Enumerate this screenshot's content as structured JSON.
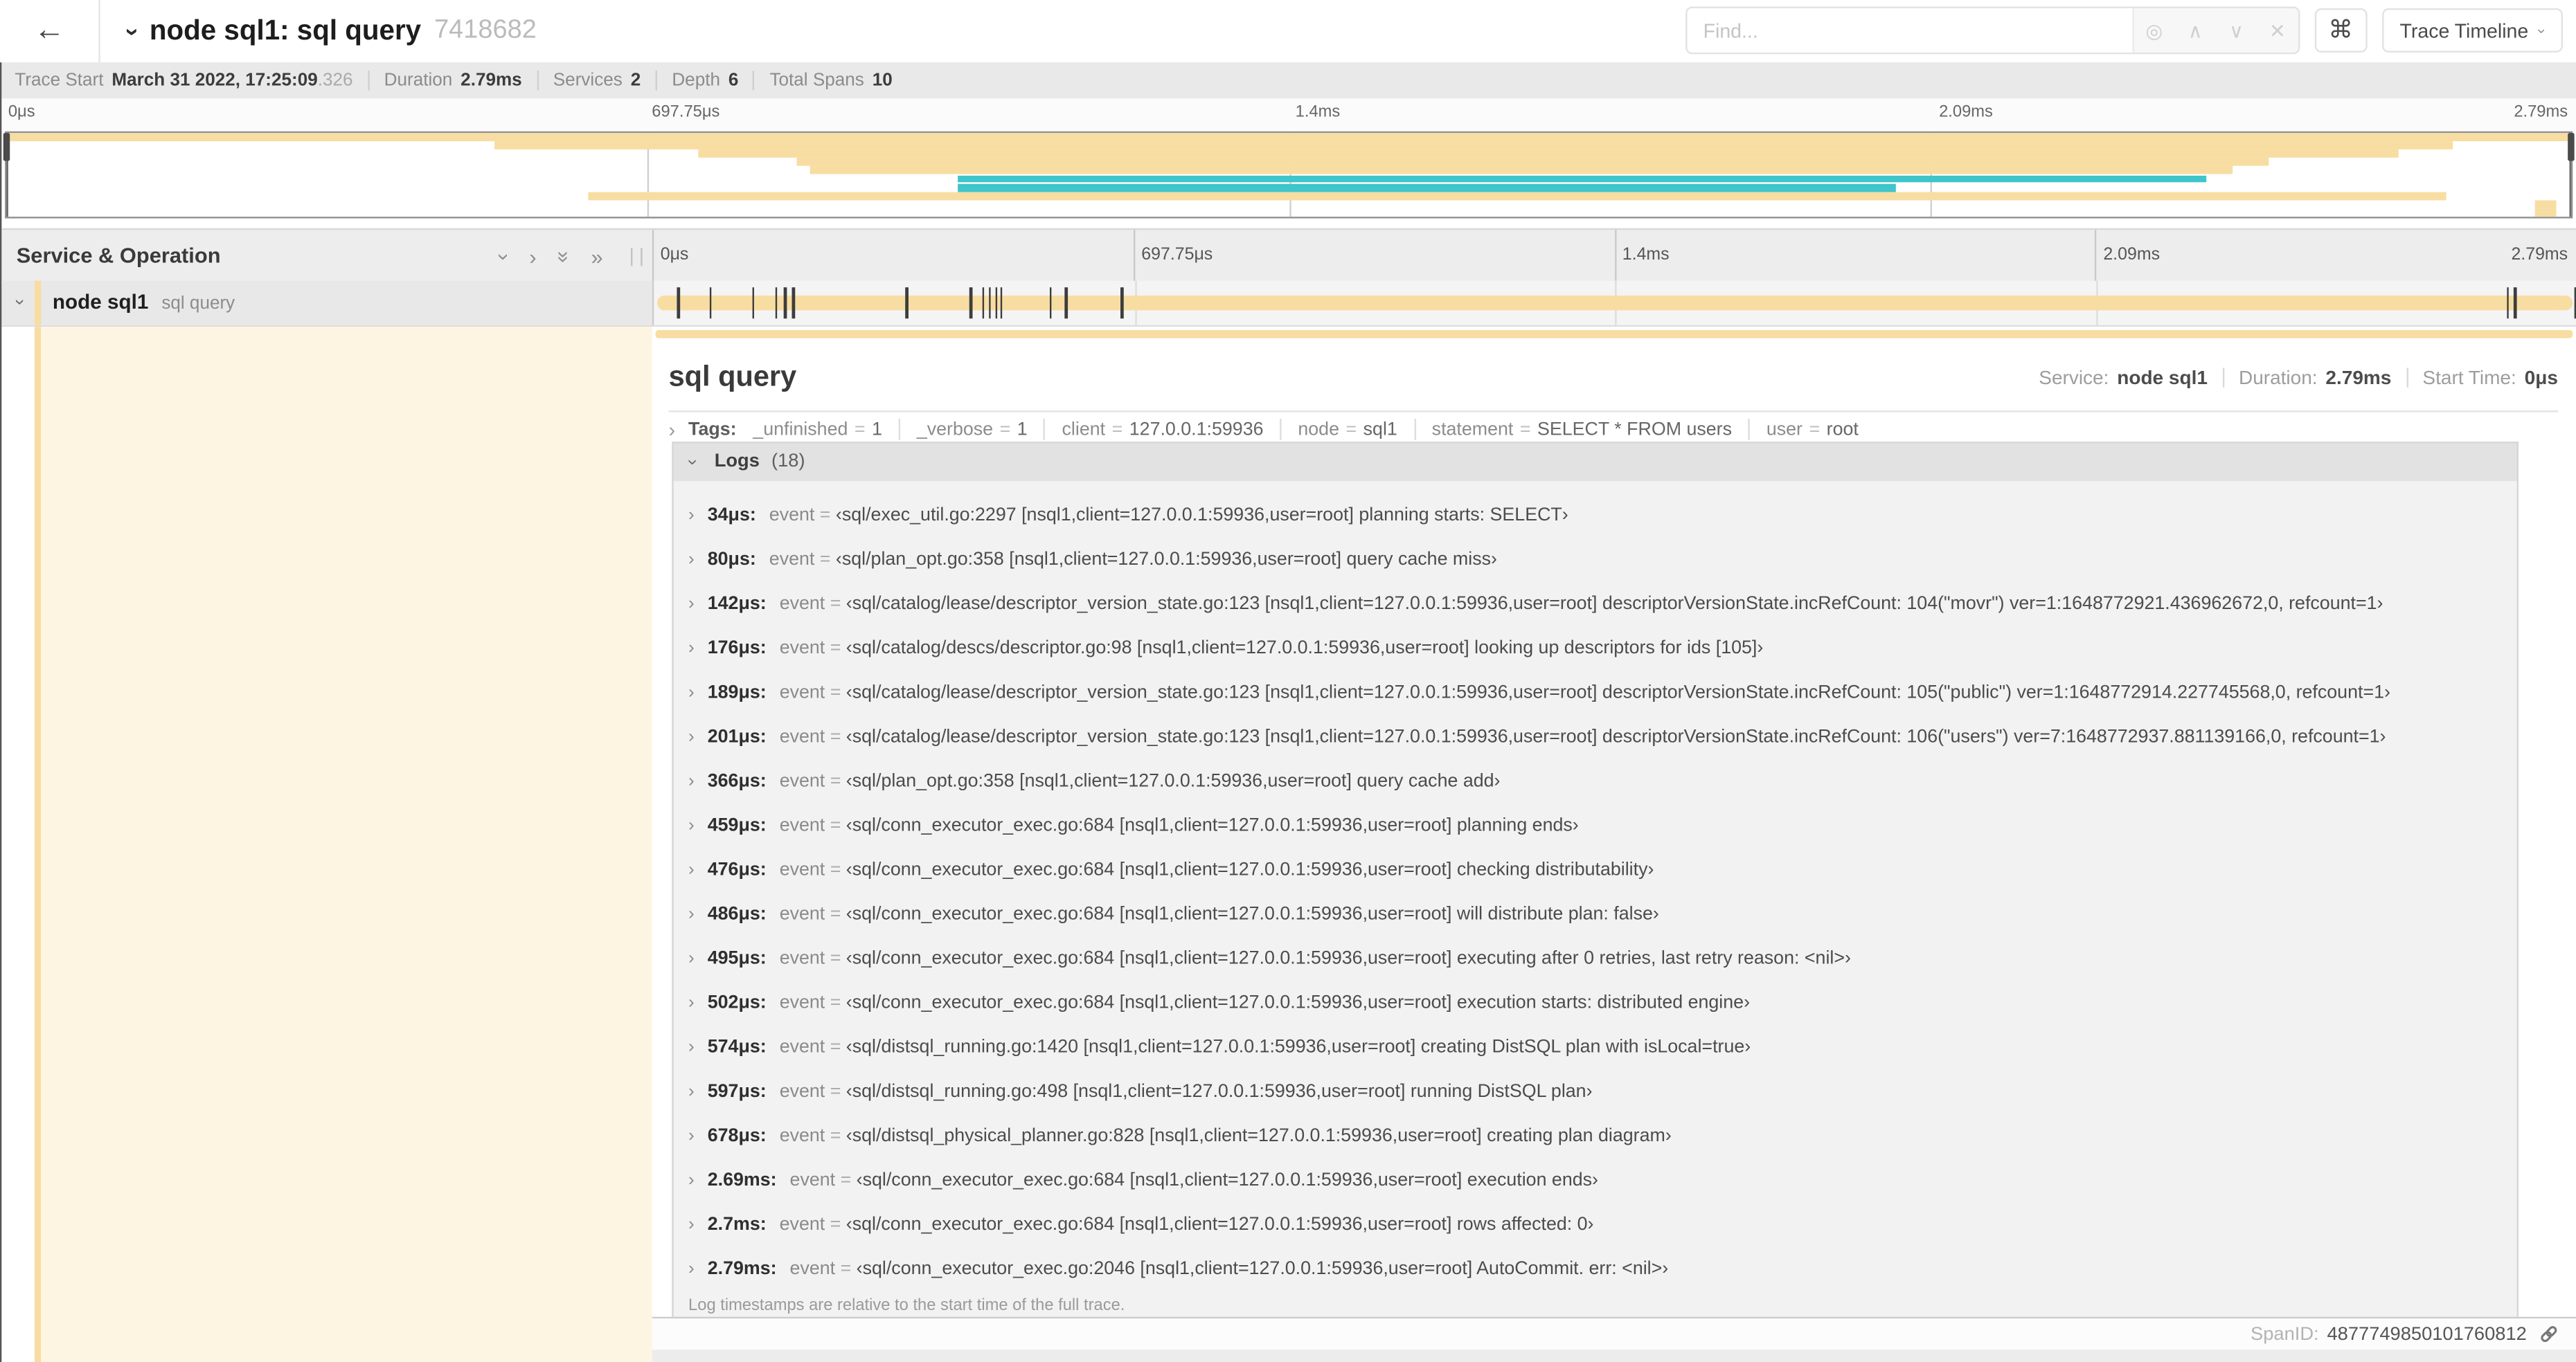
{
  "header": {
    "back_icon": "←",
    "collapse_icon": "›",
    "title": "node sql1: sql query",
    "trace_id": "7418682",
    "find_placeholder": "Find...",
    "find_buttons": [
      "◎",
      "∧",
      "∨",
      "✕"
    ],
    "shortcut_icon": "⌘",
    "view_selector": "Trace Timeline"
  },
  "summary": {
    "items": [
      {
        "label": "Trace Start",
        "value": "March 31 2022, 17:25:09",
        "suffix": ".326"
      },
      {
        "label": "Duration",
        "value": "2.79ms"
      },
      {
        "label": "Services",
        "value": "2"
      },
      {
        "label": "Depth",
        "value": "6"
      },
      {
        "label": "Total Spans",
        "value": "10"
      }
    ]
  },
  "axis_ticks": [
    "0μs",
    "697.75μs",
    "1.4ms",
    "2.09ms",
    "2.79ms"
  ],
  "minimap": {
    "spans": [
      {
        "start": 0.0,
        "end": 1.0,
        "color": "orange"
      },
      {
        "start": 0.19,
        "end": 0.954,
        "color": "orange"
      },
      {
        "start": 0.27,
        "end": 0.933,
        "color": "orange"
      },
      {
        "start": 0.308,
        "end": 0.882,
        "color": "orange"
      },
      {
        "start": 0.313,
        "end": 0.868,
        "color": "orange"
      },
      {
        "start": 0.371,
        "end": 0.858,
        "color": "teal"
      },
      {
        "start": 0.371,
        "end": 0.737,
        "color": "teal"
      },
      {
        "start": 0.227,
        "end": 0.951,
        "color": "orange"
      },
      {
        "start": 0.986,
        "end": 0.994,
        "color": "orange"
      },
      {
        "start": 0.986,
        "end": 0.994,
        "color": "orange"
      }
    ]
  },
  "timeline": {
    "left_header": "Service & Operation",
    "row": {
      "service": "node sql1",
      "operation": "sql query"
    }
  },
  "trace_duration_us": 2790,
  "detail": {
    "title": "sql query",
    "meta": [
      {
        "label": "Service:",
        "value": "node sql1"
      },
      {
        "label": "Duration:",
        "value": "2.79ms"
      },
      {
        "label": "Start Time:",
        "value": "0μs"
      }
    ],
    "tags": {
      "label": "Tags:",
      "items": [
        {
          "key": "_unfinished",
          "value": "1"
        },
        {
          "key": "_verbose",
          "value": "1"
        },
        {
          "key": "client",
          "value": "127.0.0.1:59936"
        },
        {
          "key": "node",
          "value": "sql1"
        },
        {
          "key": "statement",
          "value": "SELECT * FROM users"
        },
        {
          "key": "user",
          "value": "root"
        }
      ]
    },
    "logs": {
      "label": "Logs",
      "count": "(18)",
      "key_label": "event",
      "entries": [
        {
          "time": "34μs",
          "time_us": 34,
          "value": "sql/exec_util.go:2297 [nsql1,client=127.0.0.1:59936,user=root] planning starts: SELECT"
        },
        {
          "time": "80μs",
          "time_us": 80,
          "value": "sql/plan_opt.go:358 [nsql1,client=127.0.0.1:59936,user=root] query cache miss"
        },
        {
          "time": "142μs",
          "time_us": 142,
          "value": "sql/catalog/lease/descriptor_version_state.go:123 [nsql1,client=127.0.0.1:59936,user=root] descriptorVersionState.incRefCount: 104(\"movr\") ver=1:1648772921.436962672,0, refcount=1"
        },
        {
          "time": "176μs",
          "time_us": 176,
          "value": "sql/catalog/descs/descriptor.go:98 [nsql1,client=127.0.0.1:59936,user=root] looking up descriptors for ids [105]"
        },
        {
          "time": "189μs",
          "time_us": 189,
          "value": "sql/catalog/lease/descriptor_version_state.go:123 [nsql1,client=127.0.0.1:59936,user=root] descriptorVersionState.incRefCount: 105(\"public\") ver=1:1648772914.227745568,0, refcount=1"
        },
        {
          "time": "201μs",
          "time_us": 201,
          "value": "sql/catalog/lease/descriptor_version_state.go:123 [nsql1,client=127.0.0.1:59936,user=root] descriptorVersionState.incRefCount: 106(\"users\") ver=7:1648772937.881139166,0, refcount=1"
        },
        {
          "time": "366μs",
          "time_us": 366,
          "value": "sql/plan_opt.go:358 [nsql1,client=127.0.0.1:59936,user=root] query cache add"
        },
        {
          "time": "459μs",
          "time_us": 459,
          "value": "sql/conn_executor_exec.go:684 [nsql1,client=127.0.0.1:59936,user=root] planning ends"
        },
        {
          "time": "476μs",
          "time_us": 476,
          "value": "sql/conn_executor_exec.go:684 [nsql1,client=127.0.0.1:59936,user=root] checking distributability"
        },
        {
          "time": "486μs",
          "time_us": 486,
          "value": "sql/conn_executor_exec.go:684 [nsql1,client=127.0.0.1:59936,user=root] will distribute plan: false"
        },
        {
          "time": "495μs",
          "time_us": 495,
          "value": "sql/conn_executor_exec.go:684 [nsql1,client=127.0.0.1:59936,user=root] executing after 0 retries, last retry reason: <nil>"
        },
        {
          "time": "502μs",
          "time_us": 502,
          "value": "sql/conn_executor_exec.go:684 [nsql1,client=127.0.0.1:59936,user=root] execution starts: distributed engine"
        },
        {
          "time": "574μs",
          "time_us": 574,
          "value": "sql/distsql_running.go:1420 [nsql1,client=127.0.0.1:59936,user=root] creating DistSQL plan with isLocal=true"
        },
        {
          "time": "597μs",
          "time_us": 597,
          "value": "sql/distsql_running.go:498 [nsql1,client=127.0.0.1:59936,user=root] running DistSQL plan"
        },
        {
          "time": "678μs",
          "time_us": 678,
          "value": "sql/distsql_physical_planner.go:828 [nsql1,client=127.0.0.1:59936,user=root] creating plan diagram"
        },
        {
          "time": "2.69ms",
          "time_us": 2690,
          "value": "sql/conn_executor_exec.go:684 [nsql1,client=127.0.0.1:59936,user=root] execution ends"
        },
        {
          "time": "2.7ms",
          "time_us": 2700,
          "value": "sql/conn_executor_exec.go:684 [nsql1,client=127.0.0.1:59936,user=root] rows affected: 0"
        },
        {
          "time": "2.79ms",
          "time_us": 2790,
          "value": "sql/conn_executor_exec.go:2046 [nsql1,client=127.0.0.1:59936,user=root] AutoCommit. err: <nil>"
        }
      ]
    },
    "footer_note": "Log timestamps are relative to the start time of the full trace.",
    "span_id_label": "SpanID:",
    "span_id": "4877749850101760812"
  },
  "colors": {
    "span_orange": "#f8dda2",
    "span_teal": "#3fc5ca",
    "detail_cream": "#fdf5e1"
  }
}
